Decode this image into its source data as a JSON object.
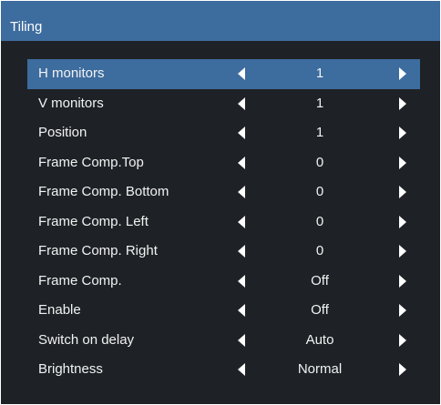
{
  "window": {
    "title": "Tiling"
  },
  "colors": {
    "accent": "#3d6c9e",
    "background": "#1e2226",
    "text": "#f2f2f2"
  },
  "menu": {
    "selected_index": 0,
    "items": [
      {
        "label": "H monitors",
        "value": "1"
      },
      {
        "label": "V monitors",
        "value": "1"
      },
      {
        "label": "Position",
        "value": "1"
      },
      {
        "label": "Frame Comp.Top",
        "value": "0"
      },
      {
        "label": "Frame Comp. Bottom",
        "value": "0"
      },
      {
        "label": "Frame Comp. Left",
        "value": "0"
      },
      {
        "label": "Frame Comp. Right",
        "value": "0"
      },
      {
        "label": "Frame Comp.",
        "value": "Off"
      },
      {
        "label": "Enable",
        "value": "Off"
      },
      {
        "label": "Switch on delay",
        "value": "Auto"
      },
      {
        "label": "Brightness",
        "value": "Normal"
      }
    ]
  },
  "icons": {
    "decrease": "triangle-left-icon",
    "increase": "triangle-right-icon"
  }
}
